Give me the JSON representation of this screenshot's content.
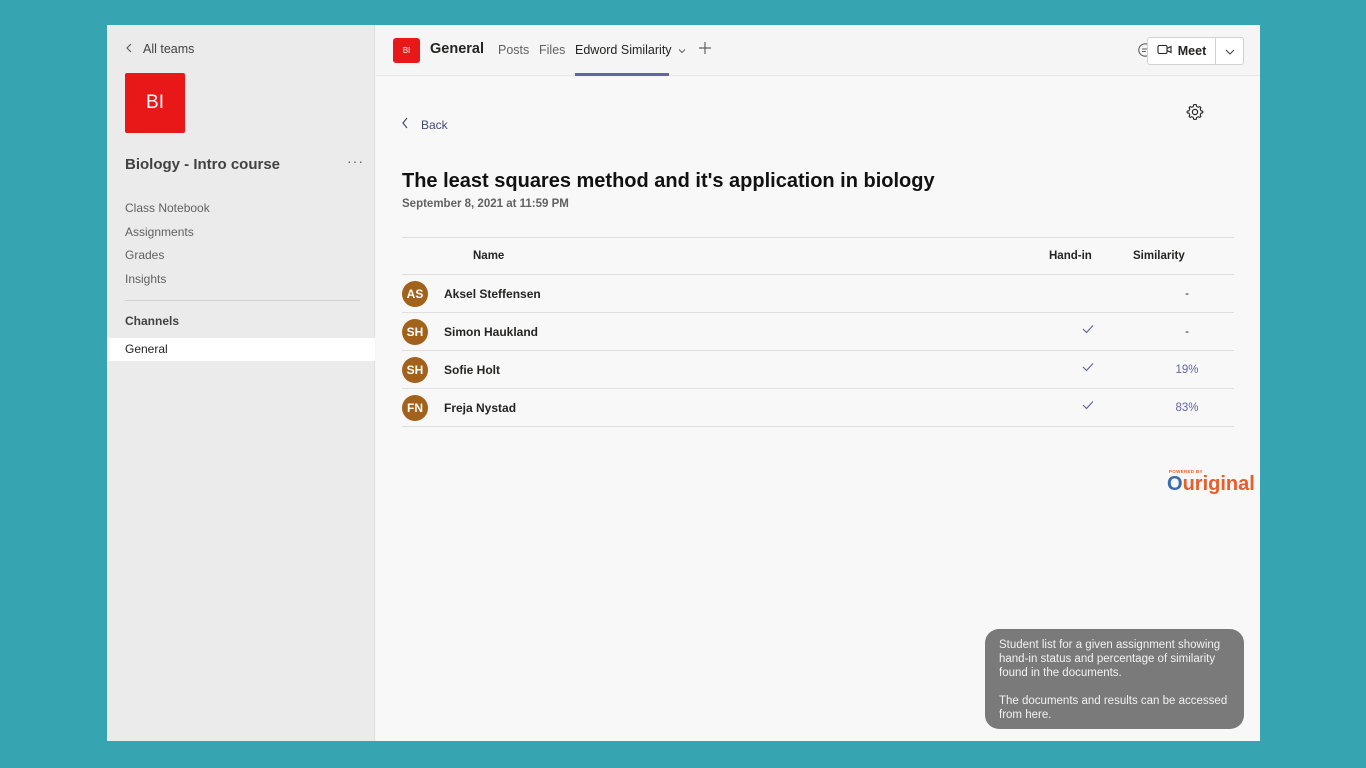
{
  "sidebar": {
    "back_label": "All teams",
    "team_initials": "BI",
    "team_name": "Biology - Intro course",
    "more": "···",
    "nav": [
      "Class Notebook",
      "Assignments",
      "Grades",
      "Insights"
    ],
    "channels_label": "Channels",
    "channel": "General"
  },
  "header": {
    "initials": "BI",
    "title": "General",
    "tabs": [
      "Posts",
      "Files",
      "Edword Similarity"
    ],
    "meet_label": "Meet"
  },
  "main": {
    "back_label": "Back",
    "title": "The least squares method and it's application in biology",
    "date": "September 8, 2021 at 11:59 PM",
    "columns": {
      "name": "Name",
      "hand_in": "Hand-in",
      "similarity": "Similarity"
    },
    "students": [
      {
        "initials": "AS",
        "name": "Aksel Steffensen",
        "handed_in": false,
        "similarity": "-"
      },
      {
        "initials": "SH",
        "name": "Simon Haukland",
        "handed_in": true,
        "similarity": "-"
      },
      {
        "initials": "SH",
        "name": "Sofie Holt",
        "handed_in": true,
        "similarity": "19%"
      },
      {
        "initials": "FN",
        "name": "Freja Nystad",
        "handed_in": true,
        "similarity": "83%"
      }
    ],
    "logo": {
      "powered": "POWERED BY",
      "o": "O",
      "rest": "uriginal"
    }
  },
  "tooltip": {
    "p1": "Student list for a given assignment showing hand-in status and percentage of similarity found in the documents.",
    "p2": "The documents and results can be accessed from here."
  },
  "colors": {
    "accent": "#6264a7",
    "team_tile": "#e81818",
    "avatar": "#a3621b",
    "background": "#36a5b1"
  }
}
